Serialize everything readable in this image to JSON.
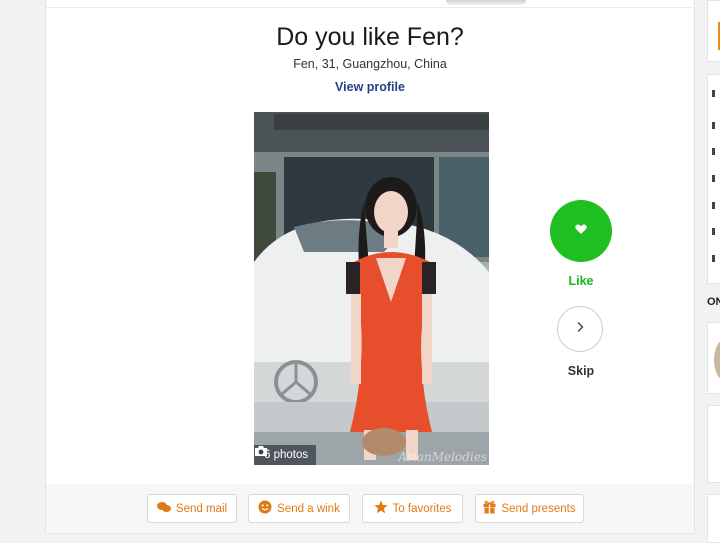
{
  "match": {
    "title": "Do you like Fen?",
    "subtitle": "Fen, 31, Guangzhou, China",
    "view_profile": "View profile"
  },
  "photo": {
    "count_label": "6 photos",
    "watermark": "AsianMelodies"
  },
  "actions": {
    "like_label": "Like",
    "skip_label": "Skip"
  },
  "action_bar": {
    "send_mail": "Send mail",
    "send_wink": "Send a wink",
    "to_favorites": "To favorites",
    "send_presents": "Send presents"
  },
  "sidebar": {
    "online_label": "ON"
  },
  "colors": {
    "like_green": "#1fbf22",
    "accent_orange": "#e07a14",
    "link_blue": "#22418b"
  },
  "icons": [
    "heart-icon",
    "chevron-right-icon",
    "camera-icon",
    "mail-icon",
    "smile-icon",
    "star-icon",
    "gift-icon"
  ]
}
